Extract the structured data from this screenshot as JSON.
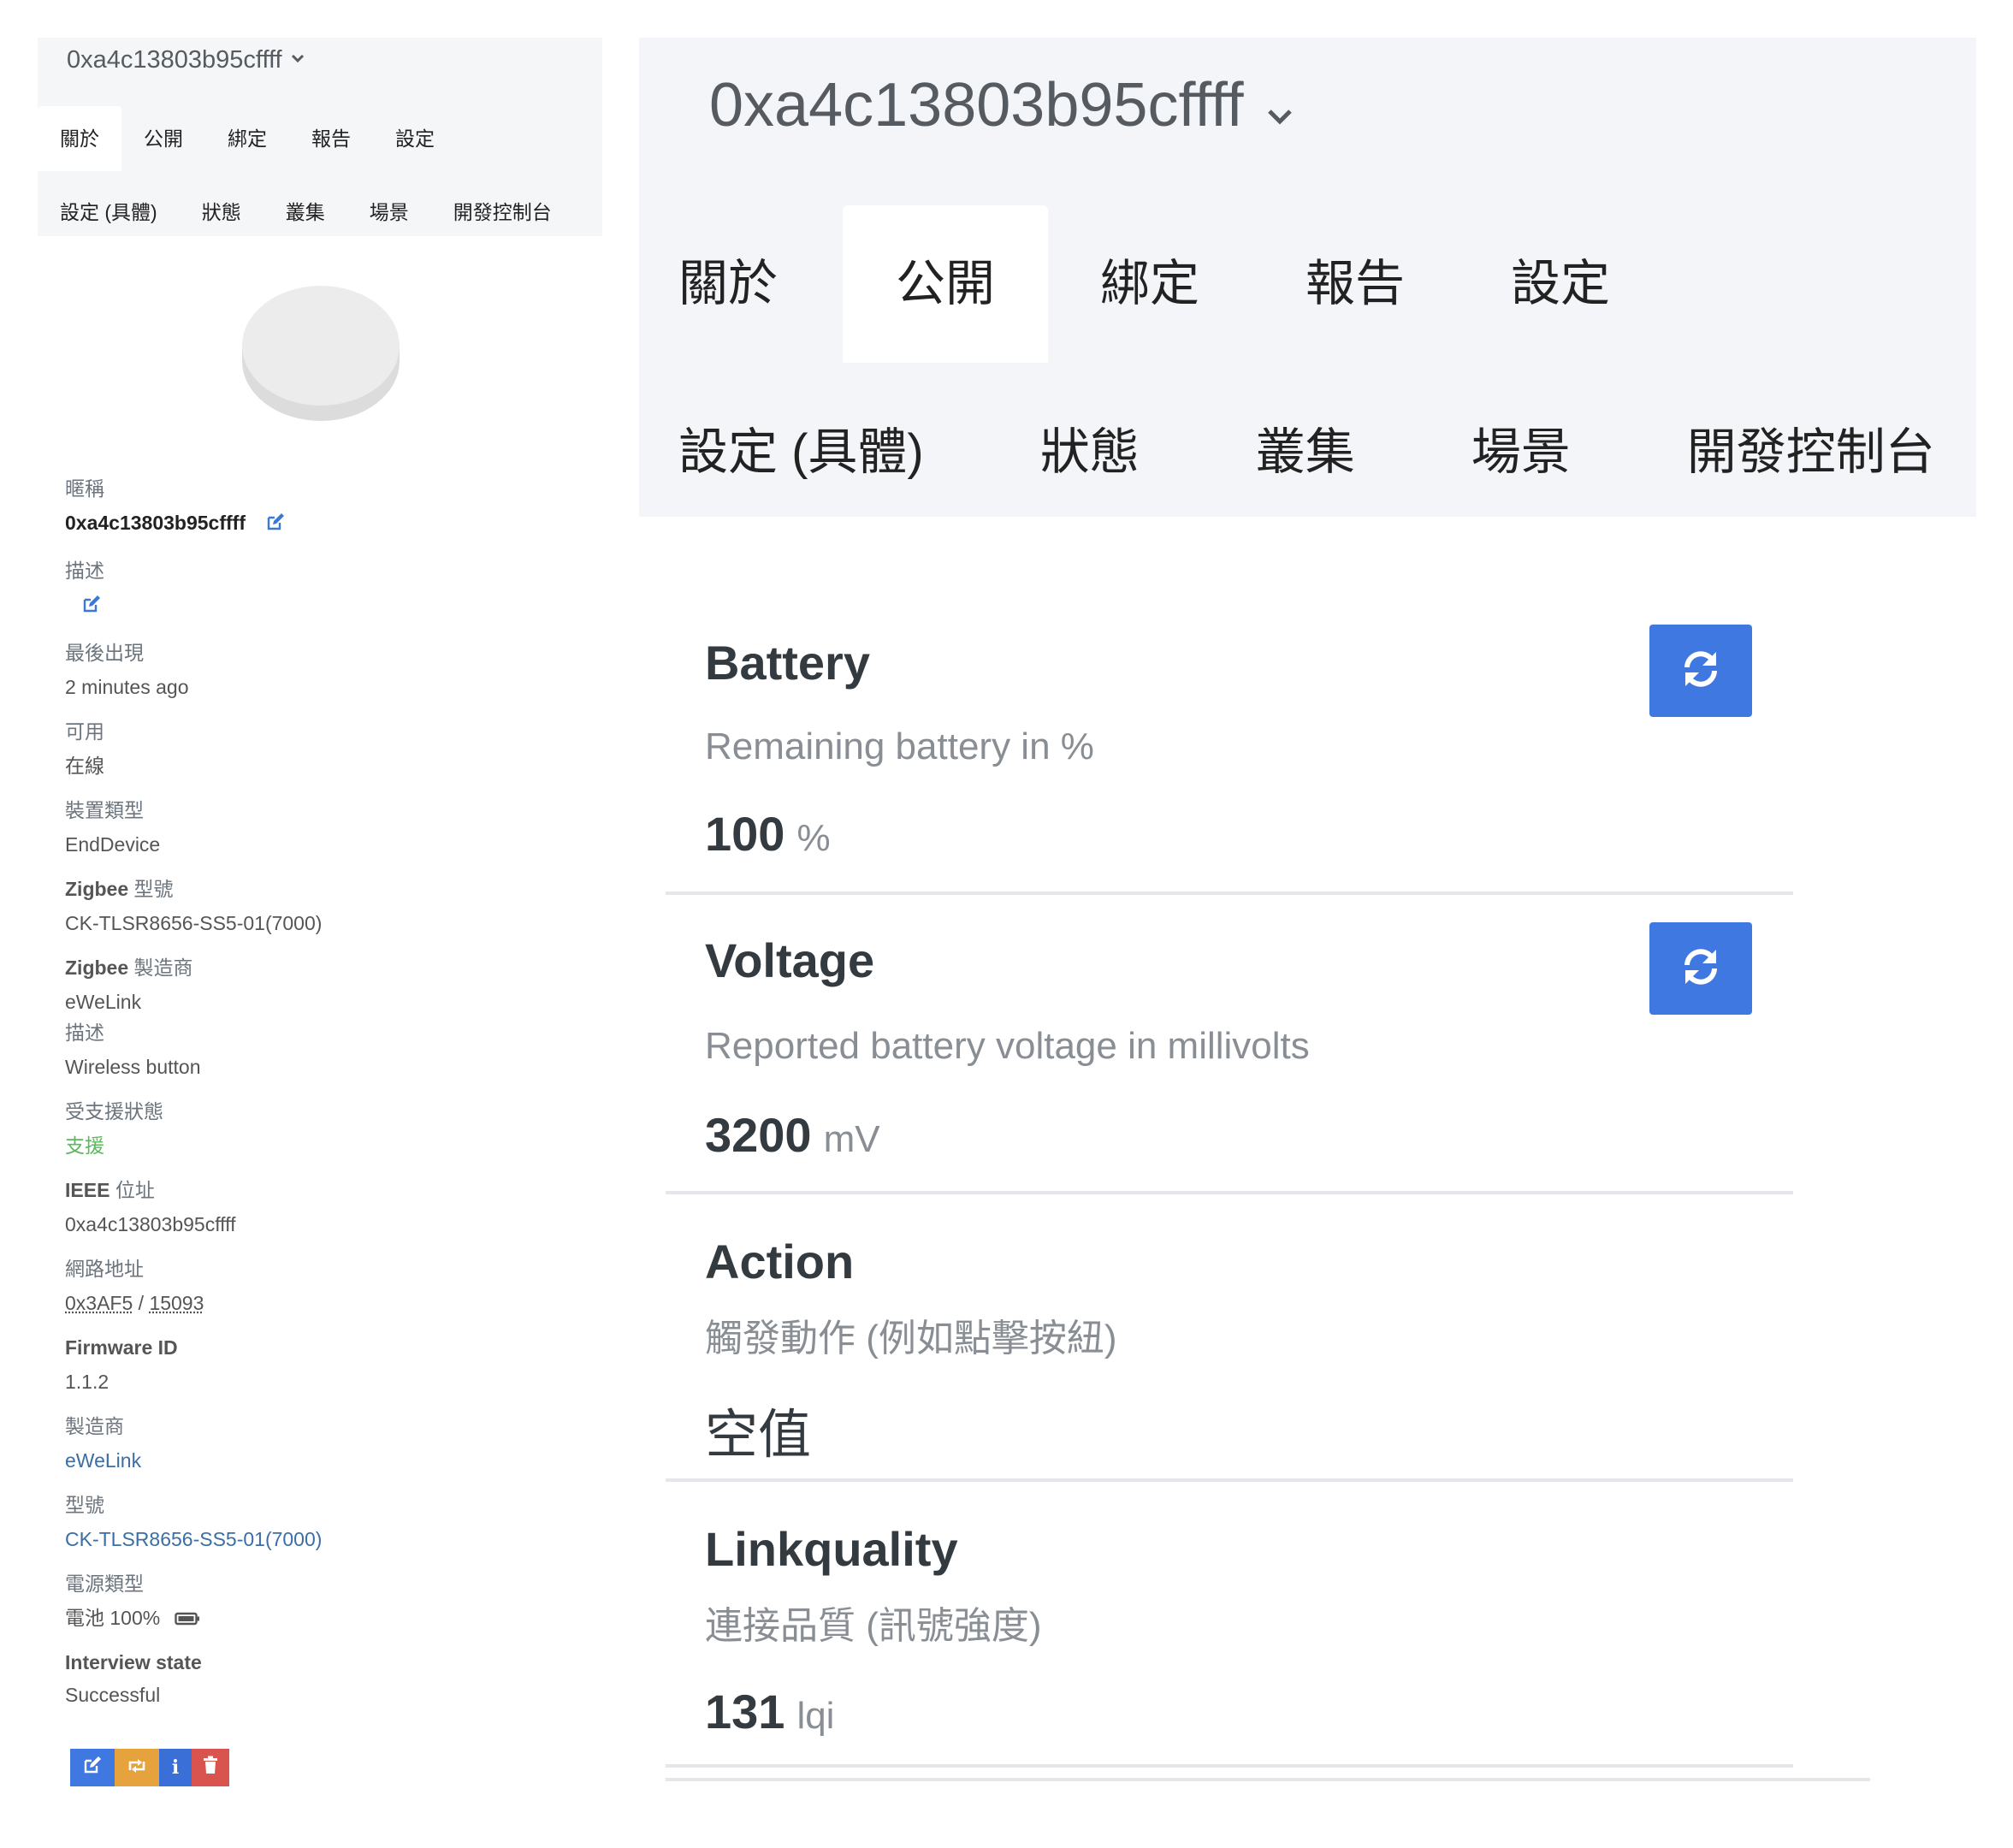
{
  "left": {
    "device_title": "0xa4c13803b95cffff",
    "tabs_row1": [
      "關於",
      "公開",
      "綁定",
      "報告",
      "設定"
    ],
    "tabs_row2": [
      "設定 (具體)",
      "狀態",
      "叢集",
      "場景",
      "開發控制台"
    ],
    "active_tab": "關於",
    "info": {
      "nickname_label": "暱稱",
      "nickname_value": "0xa4c13803b95cffff",
      "description_label": "描述",
      "last_seen_label": "最後出現",
      "last_seen_value": "2 minutes ago",
      "availability_label": "可用",
      "availability_value": "在線",
      "device_type_label": "裝置類型",
      "device_type_value": "EndDevice",
      "zigbee_model_label_prefix": "Zigbee",
      "zigbee_model_label_suffix": "型號",
      "zigbee_model_value": "CK-TLSR8656-SS5-01(7000)",
      "zigbee_mfr_label_prefix": "Zigbee",
      "zigbee_mfr_label_suffix": "製造商",
      "zigbee_mfr_value": "eWeLink",
      "description2_label": "描述",
      "description2_value": "Wireless button",
      "support_label": "受支援狀態",
      "support_value": "支援",
      "ieee_label_prefix": "IEEE",
      "ieee_label_suffix": "位址",
      "ieee_value": "0xa4c13803b95cffff",
      "network_label": "網路地址",
      "network_hex": "0x3AF5",
      "network_sep": " / ",
      "network_dec": "15093",
      "firmware_label": "Firmware ID",
      "firmware_value": "1.1.2",
      "manufacturer_label": "製造商",
      "manufacturer_value": "eWeLink",
      "model_label": "型號",
      "model_value": "CK-TLSR8656-SS5-01(7000)",
      "power_label": "電源類型",
      "power_value": "電池 100%",
      "interview_label": "Interview state",
      "interview_value": "Successful"
    },
    "action_buttons": [
      "edit-icon",
      "reconfigure-icon",
      "info-icon",
      "trash-icon"
    ]
  },
  "right": {
    "device_title": "0xa4c13803b95cffff",
    "tabs_row1": [
      "關於",
      "公開",
      "綁定",
      "報告",
      "設定"
    ],
    "tabs_row2": [
      "設定 (具體)",
      "狀態",
      "叢集",
      "場景",
      "開發控制台"
    ],
    "active_tab": "公開",
    "features": [
      {
        "name": "Battery",
        "description": "Remaining battery in %",
        "value": "100",
        "unit": "%",
        "refresh": true
      },
      {
        "name": "Voltage",
        "description": "Reported battery voltage in millivolts",
        "value": "3200",
        "unit": "mV",
        "refresh": true
      },
      {
        "name": "Action",
        "description": "觸發動作 (例如點擊按紐)",
        "value": "空值",
        "unit": "",
        "refresh": false
      },
      {
        "name": "Linkquality",
        "description": "連接品質 (訊號強度)",
        "value": "131",
        "unit": "lqi",
        "refresh": false
      }
    ]
  },
  "colors": {
    "header_bg": "#f4f5f8",
    "primary": "#3f78e0",
    "warning": "#e6a23c",
    "danger": "#d9534f",
    "success": "#5cb85c",
    "link": "#3a6ea5"
  }
}
